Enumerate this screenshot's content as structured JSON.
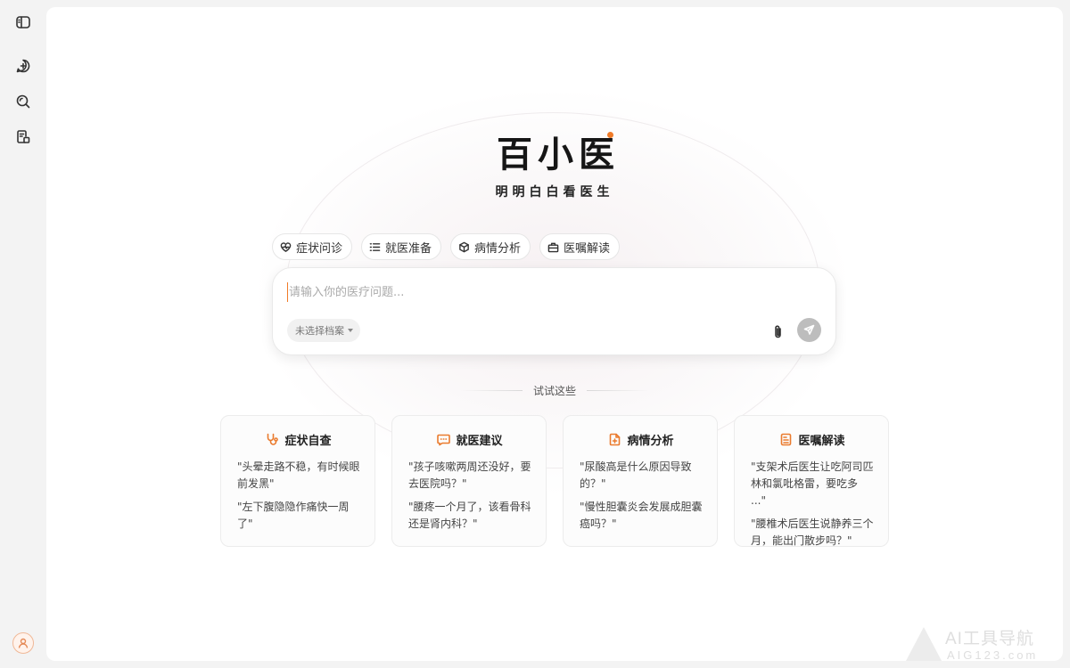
{
  "app": {
    "logo": "百小医",
    "slogan": "明明白白看医生",
    "accent_color": "#f07b28"
  },
  "rail": {
    "items": [
      {
        "icon": "sidebar-toggle-icon"
      },
      {
        "icon": "new-chat-icon"
      },
      {
        "icon": "search-icon"
      },
      {
        "icon": "records-icon"
      }
    ],
    "avatar_icon": "user-avatar-icon"
  },
  "modes": [
    {
      "label": "症状问诊",
      "icon": "heart-pulse-icon"
    },
    {
      "label": "就医准备",
      "icon": "list-icon"
    },
    {
      "label": "病情分析",
      "icon": "cube-icon"
    },
    {
      "label": "医嘱解读",
      "icon": "briefcase-icon"
    }
  ],
  "composer": {
    "placeholder": "请输入你的医疗问题...",
    "profile_select": "未选择档案",
    "attach_icon": "paperclip-icon",
    "send_icon": "send-icon"
  },
  "try_label": "试试这些",
  "cards": [
    {
      "title": "症状自查",
      "icon": "stethoscope-icon",
      "questions": [
        "\"头晕走路不稳，有时候眼前发黑\"",
        "\"左下腹隐隐作痛快一周了\""
      ]
    },
    {
      "title": "就医建议",
      "icon": "chat-bubble-icon",
      "questions": [
        "\"孩子咳嗽两周还没好，要去医院吗？\"",
        "\"腰疼一个月了，该看骨科还是肾内科？\""
      ]
    },
    {
      "title": "病情分析",
      "icon": "medical-file-icon",
      "questions": [
        "\"尿酸高是什么原因导致的？\"",
        "\"慢性胆囊炎会发展成胆囊癌吗？\""
      ]
    },
    {
      "title": "医嘱解读",
      "icon": "document-icon",
      "questions": [
        "\"支架术后医生让吃阿司匹林和氯吡格雷，要吃多 ...\"",
        "\"腰椎术后医生说静养三个月，能出门散步吗？\""
      ]
    }
  ],
  "watermark": {
    "line1": "AI工具导航",
    "line2": "AIG123.com"
  }
}
